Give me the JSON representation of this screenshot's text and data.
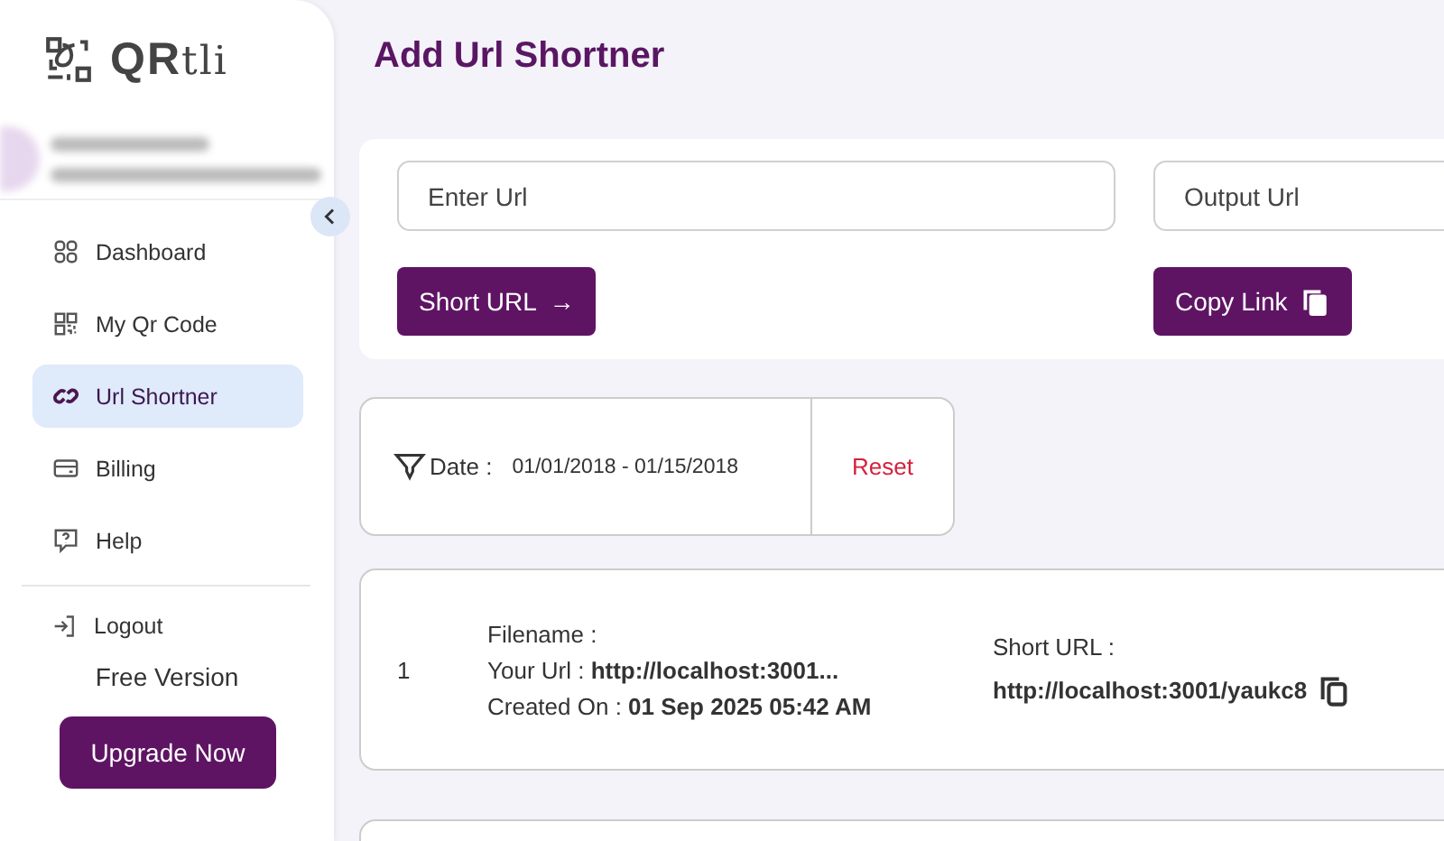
{
  "brand": {
    "name": "QR",
    "suffix": "tli"
  },
  "sidebar": {
    "items": [
      {
        "label": "Dashboard",
        "selected": false
      },
      {
        "label": "My Qr Code",
        "selected": false
      },
      {
        "label": "Url Shortner",
        "selected": true
      },
      {
        "label": "Billing",
        "selected": false
      },
      {
        "label": "Help",
        "selected": false
      }
    ],
    "logout": "Logout",
    "plan": "Free Version",
    "upgrade": "Upgrade Now"
  },
  "page": {
    "title": "Add Url Shortner"
  },
  "form": {
    "url_placeholder": "Enter Url",
    "output_placeholder": "Output Url",
    "short_button": "Short URL",
    "short_arrow": "→",
    "copy_button": "Copy Link"
  },
  "filter": {
    "label": "Date :",
    "range": "01/01/2018 - 01/15/2018",
    "reset": "Reset"
  },
  "rows": [
    {
      "index": "1",
      "filename_label": "Filename :",
      "url_label": "Your Url :",
      "url": "http://localhost:3001...",
      "created_label": "Created On :",
      "created": "01 Sep 2025 05:42 AM",
      "short_label": "Short URL :",
      "short_url": "http://localhost:3001/yaukc8"
    }
  ]
}
